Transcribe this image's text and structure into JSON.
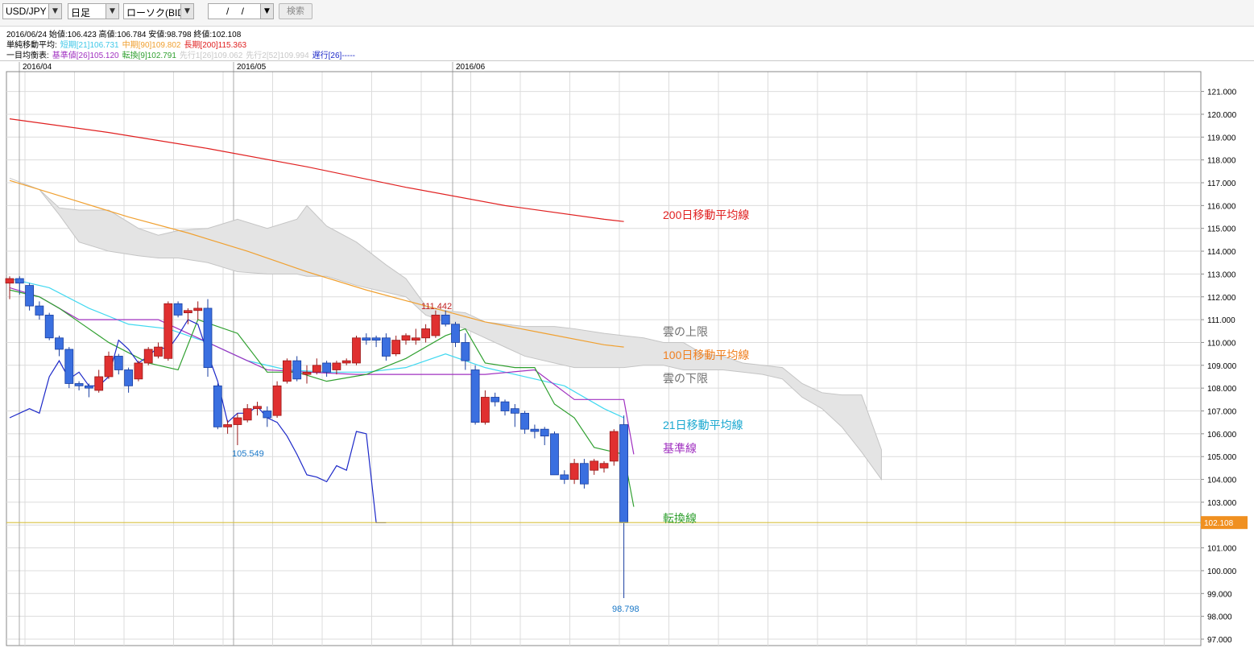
{
  "toolbar": {
    "symbol": "USD/JPY",
    "timeframe": "日足",
    "chart_type": "ローソク(BID)",
    "date_placeholder": "/ /",
    "search_label": "検索"
  },
  "info": {
    "ohlc_line": "2016/06/24  始値:106.423  高値:106.784  安値:98.798  終値:102.108",
    "sma_label": "単純移動平均:",
    "sma_short": "短期[21]106.731",
    "sma_mid": "中期[90]109.802",
    "sma_long": "長期[200]115.363",
    "ichimoku_label": "一目均衡表:",
    "kijun": "基準値[26]105.120",
    "tenkan": "転換[9]102.791",
    "senkou1": "先行1[26]109.062",
    "senkou2": "先行2[52]109.994",
    "chikou": "遅行[26]-----"
  },
  "colors": {
    "bull": "#e03030",
    "bear": "#3a6fe0",
    "sma200": "#e02020",
    "sma100": "#f0a030",
    "sma21": "#40d8f0",
    "kijun": "#a030c0",
    "tenkan": "#30a030",
    "chikou": "#1c28c8",
    "cloud": "#e4e4e4",
    "price_line": "#d8c040"
  },
  "chart_data": {
    "type": "candlestick",
    "x_tick_labels": [
      "2016/04",
      "2016/05",
      "2016/06"
    ],
    "ylim": [
      96.8,
      121.8
    ],
    "y_ticks": [
      "97.000",
      "98.000",
      "99.000",
      "100.000",
      "101.000",
      "102.000",
      "103.000",
      "104.000",
      "105.000",
      "106.000",
      "107.000",
      "108.000",
      "109.000",
      "110.000",
      "111.000",
      "112.000",
      "113.000",
      "114.000",
      "115.000",
      "116.000",
      "117.000",
      "118.000",
      "119.000",
      "120.000",
      "121.000"
    ],
    "current_price": "102.108",
    "annotations": {
      "high_label": "111.442",
      "low_label_may": "105.549",
      "low_label_jun": "98.798"
    },
    "series_labels": {
      "sma200": "200日移動平均線",
      "cloud_upper": "雲の上限",
      "sma100": "100日移動平均線",
      "cloud_lower": "雲の下限",
      "sma21": "21日移動平均線",
      "kijun": "基準線",
      "tenkan": "転換線"
    },
    "candles": [
      [
        112.6,
        112.9,
        111.9,
        112.8
      ],
      [
        112.8,
        112.9,
        112.1,
        112.6
      ],
      [
        112.5,
        112.6,
        111.4,
        111.6
      ],
      [
        111.6,
        111.8,
        111.0,
        111.2
      ],
      [
        111.2,
        111.3,
        110.1,
        110.2
      ],
      [
        110.2,
        110.3,
        109.4,
        109.7
      ],
      [
        109.7,
        109.8,
        108.0,
        108.2
      ],
      [
        108.2,
        108.3,
        107.9,
        108.1
      ],
      [
        108.1,
        108.2,
        107.6,
        108.0
      ],
      [
        107.9,
        108.8,
        107.8,
        108.5
      ],
      [
        108.5,
        109.6,
        108.4,
        109.4
      ],
      [
        109.4,
        109.5,
        108.6,
        108.8
      ],
      [
        108.8,
        108.9,
        107.8,
        108.1
      ],
      [
        108.4,
        109.2,
        108.3,
        109.1
      ],
      [
        109.1,
        109.8,
        109.0,
        109.7
      ],
      [
        109.4,
        110.0,
        109.3,
        109.8
      ],
      [
        109.3,
        111.8,
        109.2,
        111.7
      ],
      [
        111.7,
        111.8,
        111.1,
        111.2
      ],
      [
        111.3,
        111.5,
        110.8,
        111.4
      ],
      [
        111.4,
        111.8,
        111.0,
        111.5
      ],
      [
        111.5,
        111.9,
        108.5,
        108.9
      ],
      [
        108.1,
        108.2,
        106.2,
        106.3
      ],
      [
        106.3,
        106.6,
        106.0,
        106.4
      ],
      [
        106.4,
        106.9,
        105.5,
        106.7
      ],
      [
        106.6,
        107.3,
        106.5,
        107.1
      ],
      [
        107.1,
        107.4,
        106.8,
        107.2
      ],
      [
        107.0,
        107.2,
        106.3,
        106.7
      ],
      [
        106.8,
        108.3,
        106.7,
        108.1
      ],
      [
        108.3,
        109.3,
        108.2,
        109.2
      ],
      [
        109.2,
        109.4,
        108.3,
        108.4
      ],
      [
        108.6,
        109.0,
        108.2,
        108.7
      ],
      [
        108.7,
        109.3,
        108.6,
        109.0
      ],
      [
        109.1,
        109.2,
        108.5,
        108.7
      ],
      [
        108.8,
        109.2,
        108.6,
        109.1
      ],
      [
        109.1,
        109.3,
        109.0,
        109.2
      ],
      [
        109.1,
        110.3,
        109.0,
        110.2
      ],
      [
        110.2,
        110.4,
        109.9,
        110.1
      ],
      [
        110.2,
        110.3,
        109.8,
        110.1
      ],
      [
        110.2,
        110.4,
        109.2,
        109.4
      ],
      [
        109.5,
        110.3,
        109.4,
        110.1
      ],
      [
        110.1,
        110.4,
        109.9,
        110.3
      ],
      [
        110.1,
        110.6,
        109.9,
        110.2
      ],
      [
        110.2,
        110.8,
        110.0,
        110.6
      ],
      [
        110.3,
        111.4,
        110.2,
        111.2
      ],
      [
        111.2,
        111.4,
        110.7,
        110.8
      ],
      [
        110.8,
        110.9,
        109.8,
        110.0
      ],
      [
        110.0,
        110.4,
        108.8,
        109.2
      ],
      [
        108.8,
        109.0,
        106.4,
        106.5
      ],
      [
        106.5,
        107.9,
        106.4,
        107.6
      ],
      [
        107.6,
        107.8,
        107.2,
        107.4
      ],
      [
        107.4,
        107.5,
        106.8,
        107.0
      ],
      [
        107.1,
        107.3,
        106.3,
        106.9
      ],
      [
        106.9,
        107.0,
        106.0,
        106.2
      ],
      [
        106.2,
        106.4,
        105.8,
        106.1
      ],
      [
        106.2,
        106.3,
        105.5,
        105.9
      ],
      [
        106.0,
        106.1,
        104.2,
        104.2
      ],
      [
        104.2,
        104.4,
        103.8,
        104.0
      ],
      [
        104.0,
        104.9,
        103.8,
        104.7
      ],
      [
        104.7,
        104.9,
        103.6,
        103.8
      ],
      [
        104.4,
        104.9,
        104.2,
        104.8
      ],
      [
        104.5,
        104.8,
        104.3,
        104.7
      ],
      [
        104.8,
        106.2,
        104.6,
        106.1
      ],
      [
        106.4,
        106.8,
        98.8,
        102.1
      ]
    ],
    "series": [
      {
        "key": "sma200",
        "x": [
          0,
          10,
          20,
          30,
          40,
          50,
          60,
          62
        ],
        "values": [
          119.8,
          119.2,
          118.5,
          117.7,
          116.8,
          116.0,
          115.4,
          115.3
        ]
      },
      {
        "key": "sma100",
        "x": [
          0,
          6,
          12,
          18,
          24,
          30,
          36,
          42,
          48,
          54,
          60,
          62
        ],
        "values": [
          117.1,
          116.3,
          115.5,
          114.8,
          114.0,
          113.1,
          112.3,
          111.6,
          110.9,
          110.4,
          109.9,
          109.8
        ]
      },
      {
        "key": "sma21",
        "x": [
          0,
          4,
          8,
          12,
          16,
          20,
          24,
          28,
          32,
          36,
          40,
          44,
          48,
          52,
          56,
          60,
          62
        ],
        "values": [
          112.8,
          112.4,
          111.5,
          110.8,
          110.6,
          110.0,
          109.2,
          108.8,
          108.7,
          108.7,
          108.9,
          109.5,
          108.9,
          108.5,
          108.1,
          107.1,
          106.7
        ]
      },
      {
        "key": "kijun",
        "x": [
          0,
          3,
          7,
          15,
          17,
          22,
          26,
          30,
          35,
          40,
          44,
          48,
          53,
          57,
          62,
          63
        ],
        "values": [
          112.4,
          112.0,
          111.0,
          111.0,
          110.6,
          109.6,
          108.8,
          108.7,
          108.6,
          108.6,
          108.6,
          108.6,
          108.8,
          107.5,
          107.5,
          105.1
        ]
      },
      {
        "key": "tenkan",
        "x": [
          0,
          3,
          5,
          7,
          10,
          14,
          17,
          19,
          23,
          26,
          29,
          32,
          36,
          40,
          44,
          46,
          48,
          51,
          53,
          55,
          57,
          59,
          61,
          62,
          63
        ],
        "values": [
          112.3,
          112.0,
          111.5,
          110.9,
          110.0,
          109.1,
          108.8,
          111.0,
          110.4,
          108.7,
          108.7,
          108.3,
          108.6,
          109.3,
          110.3,
          110.6,
          109.1,
          108.9,
          108.9,
          107.3,
          106.7,
          105.4,
          105.2,
          105.1,
          102.8
        ]
      },
      {
        "key": "chikou",
        "x": [
          0,
          2,
          3,
          4,
          5,
          6,
          7,
          8,
          9,
          10,
          11,
          12,
          13,
          14,
          15,
          16,
          17,
          18,
          19,
          20,
          21,
          22,
          23,
          24,
          25,
          26,
          27,
          28,
          29,
          30,
          31,
          32,
          33,
          34,
          35,
          36,
          37,
          38
        ],
        "values": [
          106.7,
          107.1,
          106.9,
          108.5,
          109.2,
          108.4,
          108.7,
          108.1,
          108.1,
          108.5,
          110.1,
          109.7,
          109.1,
          109.4,
          109.8,
          109.7,
          110.3,
          111.0,
          110.8,
          109.5,
          108.3,
          106.5,
          106.9,
          106.9,
          107.2,
          106.7,
          106.5,
          105.9,
          105.1,
          104.2,
          104.1,
          103.9,
          104.6,
          104.4,
          106.1,
          106.0,
          102.1,
          102.1
        ]
      }
    ],
    "cloud": {
      "x": [
        0,
        3,
        5,
        7,
        10,
        13,
        15,
        17,
        20,
        23,
        26,
        29,
        30,
        32,
        35,
        38,
        40,
        42,
        44,
        46,
        48,
        50,
        52,
        55,
        57,
        60,
        62,
        64,
        66,
        68,
        70,
        72,
        74,
        76,
        78,
        80,
        82,
        84,
        86,
        88
      ],
      "upper": [
        117.2,
        116.7,
        115.9,
        115.8,
        115.8,
        115.0,
        114.7,
        114.9,
        115.0,
        115.4,
        115.0,
        115.4,
        116.0,
        115.1,
        114.4,
        113.4,
        112.8,
        111.6,
        111.4,
        111.3,
        110.9,
        110.8,
        110.7,
        110.7,
        110.6,
        110.4,
        110.3,
        110.2,
        110.0,
        110.0,
        109.5,
        109.4,
        109.1,
        109.0,
        108.9,
        108.2,
        107.8,
        107.7,
        107.7,
        105.3
      ],
      "lower": [
        117.2,
        116.7,
        115.6,
        114.4,
        114.0,
        113.8,
        113.7,
        113.7,
        113.5,
        113.1,
        113.0,
        113.0,
        112.9,
        112.9,
        112.5,
        112.2,
        112.0,
        111.2,
        110.9,
        110.6,
        110.2,
        109.8,
        109.4,
        109.1,
        108.9,
        108.9,
        108.9,
        109.0,
        109.0,
        108.8,
        108.8,
        108.8,
        108.7,
        108.6,
        108.4,
        107.6,
        107.1,
        106.3,
        105.2,
        104.0
      ]
    }
  }
}
